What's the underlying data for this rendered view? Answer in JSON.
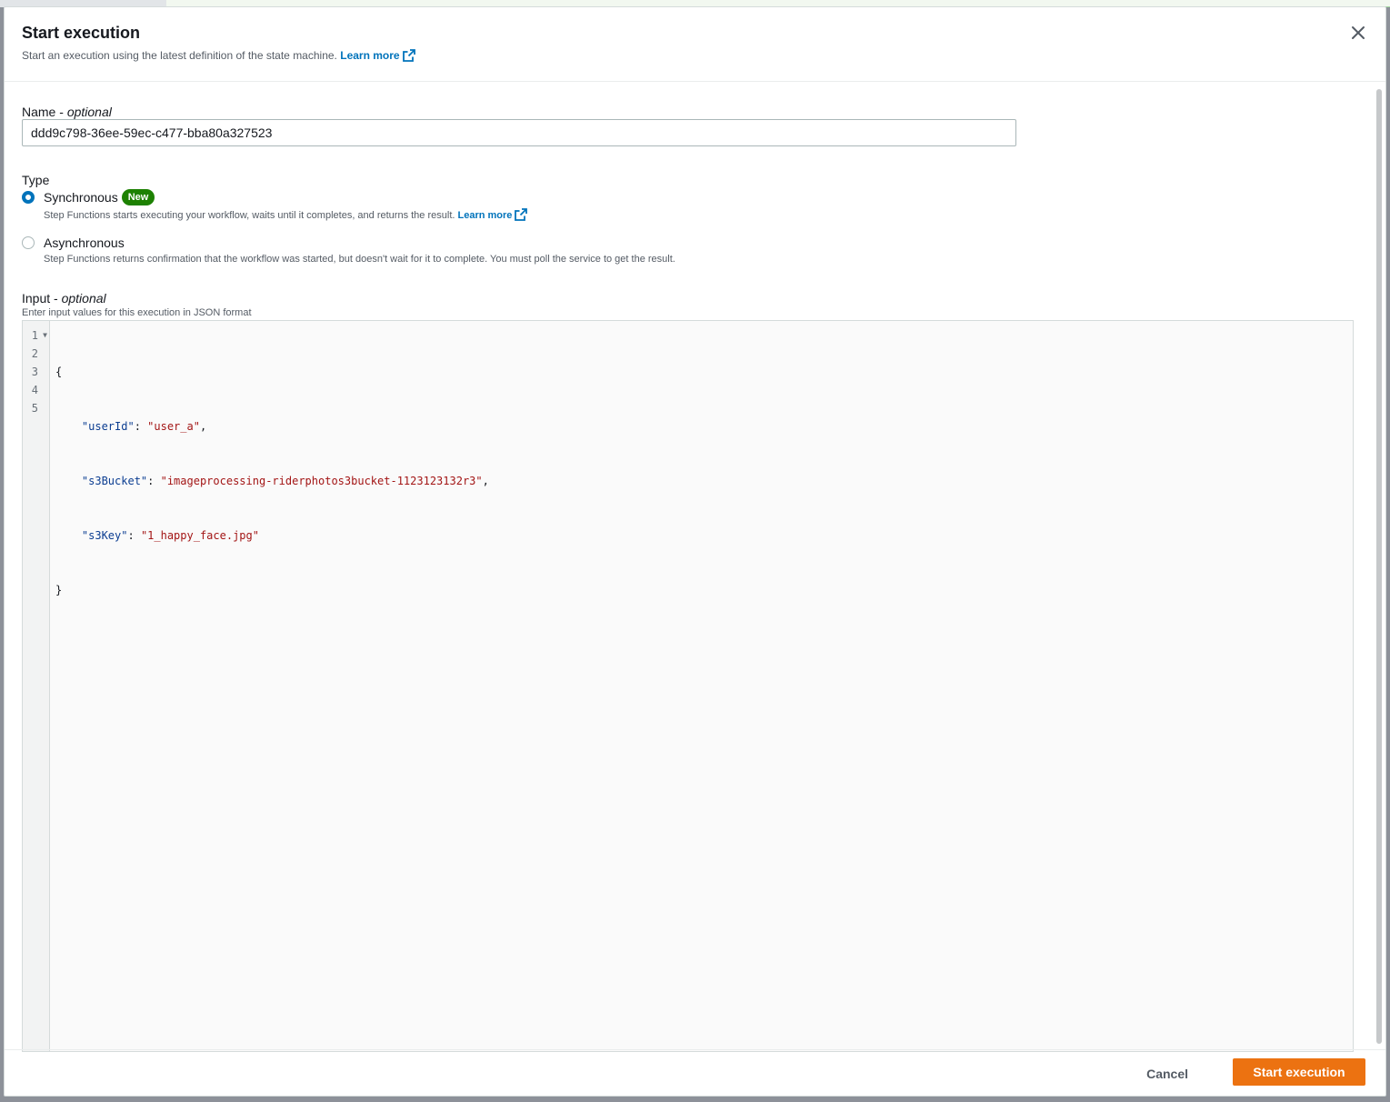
{
  "modal": {
    "title": "Start execution",
    "subtitle": "Start an execution using the latest definition of the state machine.",
    "learn_more": "Learn more"
  },
  "name_field": {
    "label": "Name",
    "label_suffix": "optional",
    "value": "ddd9c798-36ee-59ec-c477-bba80a327523"
  },
  "type_field": {
    "label": "Type",
    "options": [
      {
        "label": "Synchronous",
        "badge": "New",
        "description": "Step Functions starts executing your workflow, waits until it completes, and returns the result.",
        "learn_more": "Learn more",
        "selected": true
      },
      {
        "label": "Asynchronous",
        "description": "Step Functions returns confirmation that the workflow was started, but doesn't wait for it to complete. You must poll the service to get the result.",
        "selected": false
      }
    ]
  },
  "input_field": {
    "label": "Input",
    "label_suffix": "optional",
    "description": "Enter input values for this execution in JSON format",
    "line_numbers": [
      "1",
      "2",
      "3",
      "4",
      "5"
    ],
    "lines": {
      "l1": "{",
      "l2_key": "\"userId\"",
      "l2_val": "\"user_a\"",
      "l3_key": "\"s3Bucket\"",
      "l3_val": "\"imageprocessing-riderphotos3bucket-1123123132r3\"",
      "l4_key": "\"s3Key\"",
      "l4_val": "\"1_happy_face.jpg\"",
      "l5": "}"
    }
  },
  "footer": {
    "cancel_label": "Cancel",
    "start_label": "Start execution"
  },
  "colors": {
    "primary": "#ec7211",
    "link": "#0073bb",
    "badge": "#1d8102"
  }
}
